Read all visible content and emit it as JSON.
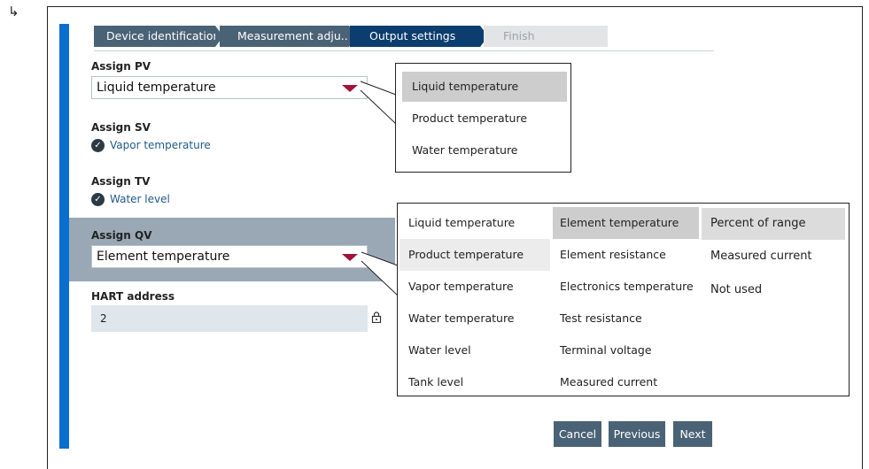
{
  "step_marker": "↳",
  "wizard": {
    "steps": [
      {
        "label": "Device identification",
        "state": "done"
      },
      {
        "label": "Measurement adju...",
        "state": "done"
      },
      {
        "label": "Output settings",
        "state": "active"
      },
      {
        "label": "Finish",
        "state": "pending"
      }
    ]
  },
  "form": {
    "pv": {
      "label": "Assign PV",
      "value": "Liquid temperature"
    },
    "sv": {
      "label": "Assign SV",
      "value": "Vapor temperature"
    },
    "tv": {
      "label": "Assign TV",
      "value": "Water level"
    },
    "qv": {
      "label": "Assign QV",
      "value": "Element temperature"
    },
    "hart": {
      "label": "HART address",
      "value": "2"
    }
  },
  "pv_dropdown": {
    "options": [
      "Liquid temperature",
      "Product temperature",
      "Water temperature"
    ],
    "selected": "Liquid temperature"
  },
  "qv_dropdown": {
    "col1": [
      "Liquid temperature",
      "Product temperature",
      "Vapor temperature",
      "Water temperature",
      "Water level",
      "Tank level"
    ],
    "col2": [
      "Element temperature",
      "Element resistance",
      "Electronics temperature",
      "Test resistance",
      "Terminal voltage",
      "Measured current"
    ],
    "col3": [
      "Percent of range",
      "Measured current",
      "Not used"
    ],
    "selected": "Element temperature"
  },
  "buttons": {
    "cancel": "Cancel",
    "previous": "Previous",
    "next": "Next"
  },
  "colors": {
    "accent_blue": "#0a6ecf",
    "step_done": "#4a6275",
    "step_active": "#0b3e6e",
    "caret": "#a3123a"
  },
  "icons": {
    "status": "check-circle-icon",
    "lock": "lock-icon"
  }
}
